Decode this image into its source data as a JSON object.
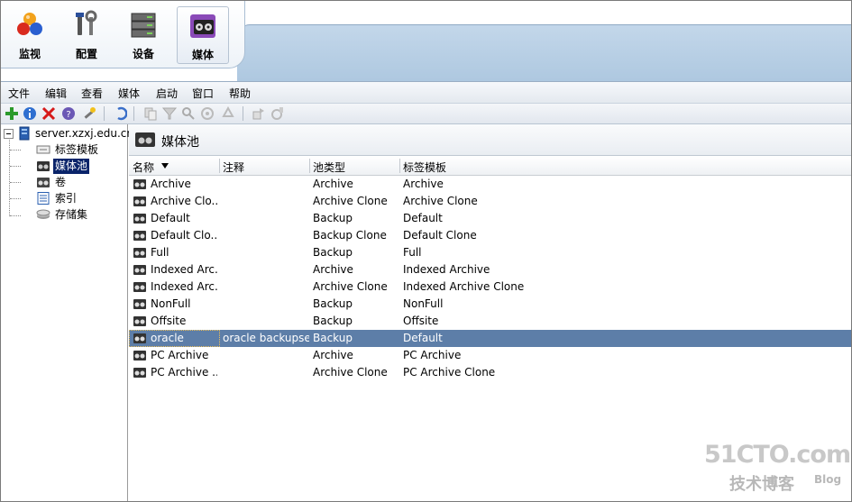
{
  "nav": {
    "items": [
      {
        "label": "监视",
        "icon": "monitor-icon"
      },
      {
        "label": "配置",
        "icon": "configure-icon"
      },
      {
        "label": "设备",
        "icon": "devices-icon"
      },
      {
        "label": "媒体",
        "icon": "media-icon",
        "selected": true
      }
    ]
  },
  "menu": {
    "items": [
      "文件",
      "编辑",
      "查看",
      "媒体",
      "启动",
      "窗口",
      "帮助"
    ]
  },
  "toolbar": {
    "icons": [
      "add-icon",
      "info-icon",
      "delete-icon",
      "help-icon",
      "wizard-icon",
      "undo-icon",
      "copy-icon",
      "filter-icon",
      "search-icon",
      "eject-icon",
      "recycle-icon",
      "move-icon",
      "properties-icon"
    ]
  },
  "tree": {
    "root": "server.xzxj.edu.cn",
    "children": [
      {
        "label": "标签模板",
        "icon": "label-template-icon"
      },
      {
        "label": "媒体池",
        "icon": "media-pool-icon",
        "selected": true
      },
      {
        "label": "卷",
        "icon": "volume-icon"
      },
      {
        "label": "索引",
        "icon": "index-icon"
      },
      {
        "label": "存储集",
        "icon": "storage-set-icon"
      }
    ]
  },
  "panel": {
    "title": "媒体池",
    "columns": [
      "名称",
      "注释",
      "池类型",
      "标签模板"
    ],
    "rows": [
      {
        "name": "Archive",
        "comment": "",
        "type": "Archive",
        "template": "Archive"
      },
      {
        "name": "Archive Clo...",
        "comment": "",
        "type": "Archive Clone",
        "template": "Archive Clone"
      },
      {
        "name": "Default",
        "comment": "",
        "type": "Backup",
        "template": "Default"
      },
      {
        "name": "Default Clo...",
        "comment": "",
        "type": "Backup Clone",
        "template": "Default Clone"
      },
      {
        "name": "Full",
        "comment": "",
        "type": "Backup",
        "template": "Full"
      },
      {
        "name": "Indexed Arc...",
        "comment": "",
        "type": "Archive",
        "template": "Indexed Archive"
      },
      {
        "name": "Indexed Arc...",
        "comment": "",
        "type": "Archive Clone",
        "template": "Indexed Archive Clone"
      },
      {
        "name": "NonFull",
        "comment": "",
        "type": "Backup",
        "template": "NonFull"
      },
      {
        "name": "Offsite",
        "comment": "",
        "type": "Backup",
        "template": "Offsite"
      },
      {
        "name": "oracle",
        "comment": "oracle backupset",
        "type": "Backup",
        "template": "Default",
        "selected": true
      },
      {
        "name": "PC Archive",
        "comment": "",
        "type": "Archive",
        "template": "PC Archive"
      },
      {
        "name": "PC Archive ...",
        "comment": "",
        "type": "Archive Clone",
        "template": "PC Archive Clone"
      }
    ]
  },
  "watermark": {
    "line1": "51CTO.com",
    "line2": "技术博客",
    "line3": "Blog"
  },
  "colors": {
    "selection": "#5d7ea8",
    "tree_selection": "#0a246a",
    "banner": "#b5cde3"
  }
}
